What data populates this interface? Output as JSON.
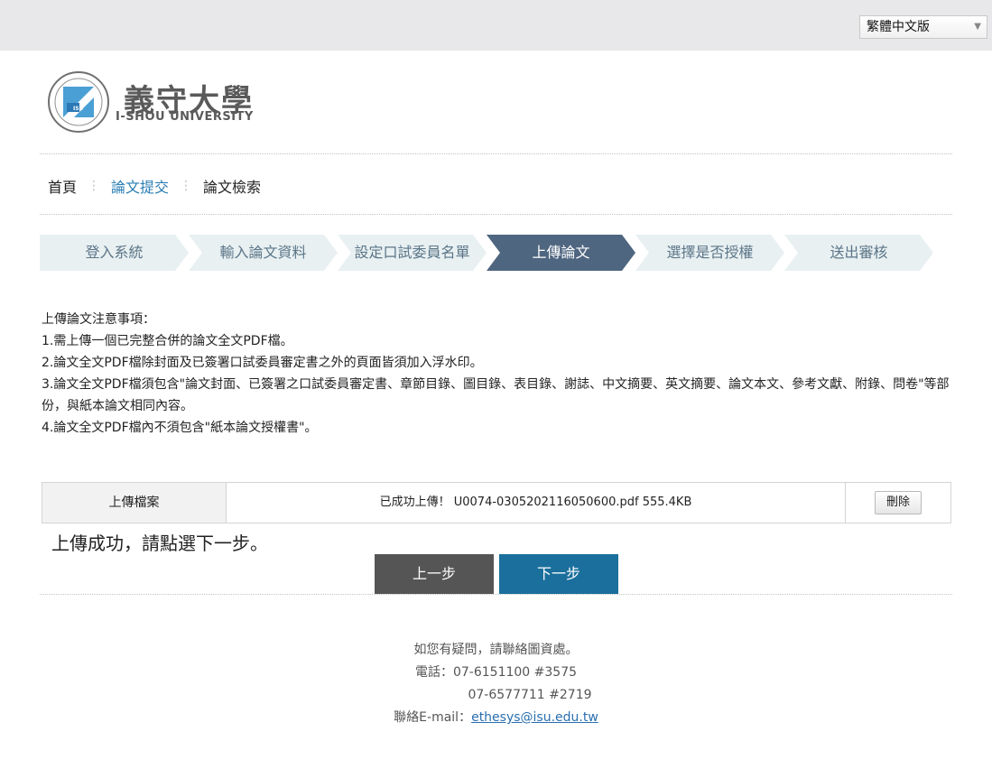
{
  "header": {
    "language_selector": "繁體中文版"
  },
  "logo": {
    "name_zh": "義守大學",
    "name_en": "I-SHOU UNIVERSITY",
    "seal_text": "ISU"
  },
  "nav": {
    "home": "首頁",
    "submit": "論文提交",
    "search": "論文檢索",
    "separator": "⋮"
  },
  "steps": [
    {
      "label": "登入系統",
      "current": false
    },
    {
      "label": "輸入論文資料",
      "current": false
    },
    {
      "label": "設定口試委員名單",
      "current": false
    },
    {
      "label": "上傳論文",
      "current": true
    },
    {
      "label": "選擇是否授權",
      "current": false
    },
    {
      "label": "送出審核",
      "current": false
    }
  ],
  "notes": {
    "title": "上傳論文注意事項：",
    "item1": "1.需上傳一個已完整合併的論文全文PDF檔。",
    "item2": "2.論文全文PDF檔除封面及已簽署口試委員審定書之外的頁面皆須加入浮水印。",
    "item3": "3.論文全文PDF檔須包含\"論文封面、已簽署之口試委員審定書、章節目錄、圖目錄、表目錄、謝誌、中文摘要、英文摘要、論文本文、參考文獻、附錄、問卷\"等部份，與紙本論文相同內容。",
    "item4": "4.論文全文PDF檔內不須包含\"紙本論文授權書\"。"
  },
  "upload": {
    "label": "上傳檔案",
    "status": "已成功上傳！ U0074-0305202116050600.pdf 555.4KB",
    "delete_label": "刪除"
  },
  "success_message": "上傳成功，請點選下一步。",
  "buttons": {
    "prev": "上一步",
    "next": "下一步"
  },
  "footer": {
    "contact": "如您有疑問，請聯絡圖資處。",
    "phone1": "電話：07-6151100 #3575",
    "phone2": "07-6577711 #2719",
    "email_label": "聯絡E-mail：",
    "email": "ethesys@isu.edu.tw"
  },
  "colors": {
    "step_current": "#4f6680",
    "step_default": "#e8f0f2",
    "next_button": "#1a6f9c",
    "prev_button": "#555555",
    "link": "#2a7db3"
  }
}
